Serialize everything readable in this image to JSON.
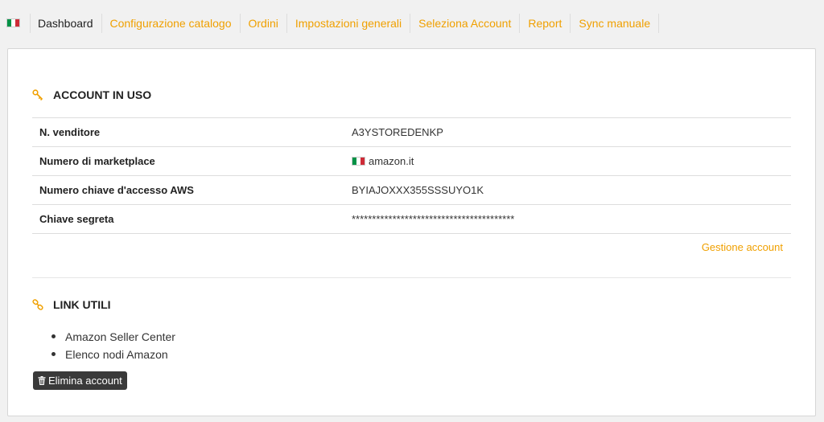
{
  "nav": {
    "items": [
      {
        "label": "Dashboard",
        "active": true
      },
      {
        "label": "Configurazione catalogo"
      },
      {
        "label": "Ordini"
      },
      {
        "label": "Impostazioni generali"
      },
      {
        "label": "Seleziona Account"
      },
      {
        "label": "Report"
      },
      {
        "label": "Sync manuale"
      }
    ]
  },
  "account": {
    "title": "ACCOUNT IN USO",
    "icon": "key-icon",
    "rows": [
      {
        "label": "N. venditore",
        "value": "A3YSTOREDENKP"
      },
      {
        "label": "Numero di marketplace",
        "value": "amazon.it"
      },
      {
        "label": "Numero chiave d'accesso AWS",
        "value": "BYIAJOXXX355SSSUYO1K"
      },
      {
        "label": "Chiave segreta",
        "value": "****************************************"
      }
    ],
    "manage_label": "Gestione account"
  },
  "links": {
    "title": "LINK UTILI",
    "icon": "link-icon",
    "items": [
      "Amazon Seller Center",
      "Elenco nodi Amazon"
    ]
  },
  "delete_button": {
    "label": "Elimina account",
    "icon": "trash-icon"
  },
  "colors": {
    "accent": "#f0a000",
    "button_bg": "#3a3a3a"
  }
}
